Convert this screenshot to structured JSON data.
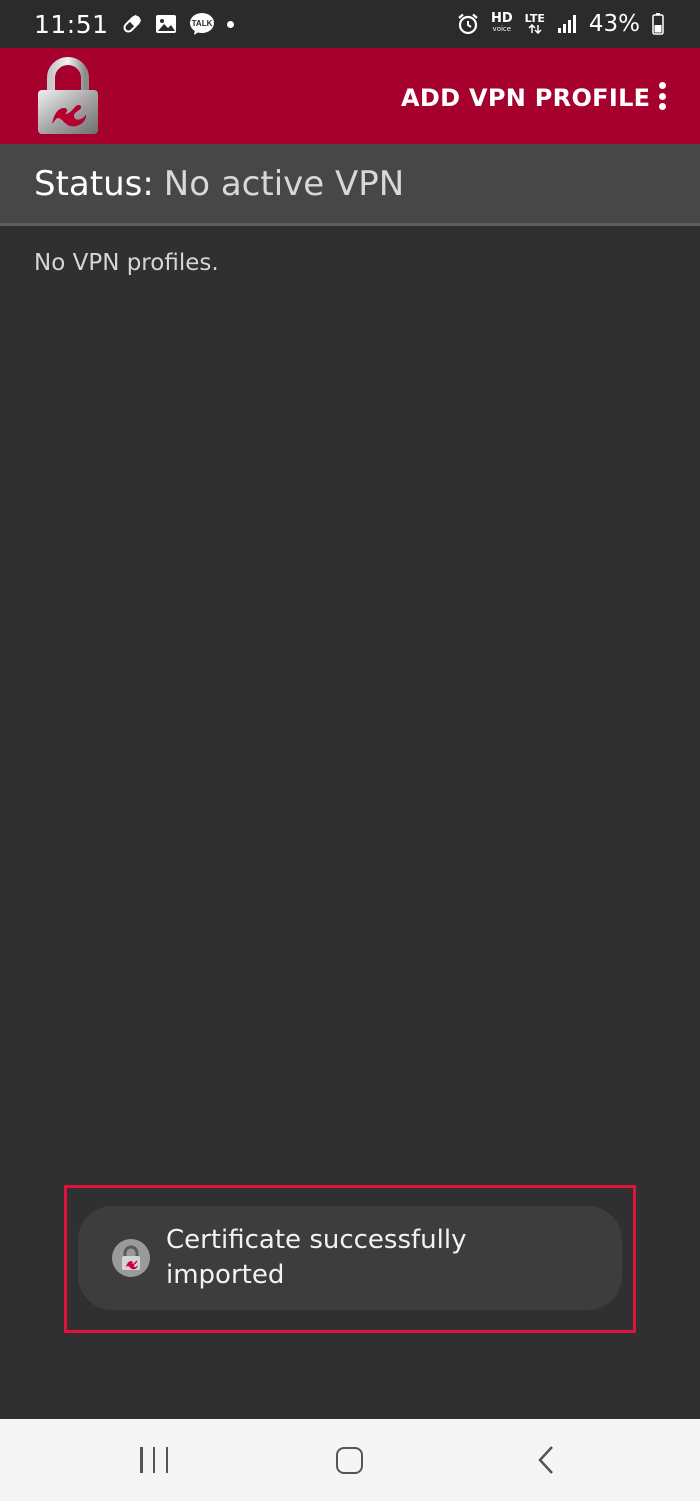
{
  "status_bar": {
    "time": "11:51",
    "left_icons": [
      "pill-icon",
      "image-icon",
      "talk-icon",
      "notification-dot-icon"
    ],
    "right_icons": [
      "alarm-icon",
      "hd-voice-icon",
      "lte-icon",
      "signal-icon",
      "battery-icon"
    ],
    "hd_label": "HD",
    "hd_sub": "voice",
    "lte_label": "LTE",
    "talk_label": "TALK",
    "battery": "43%"
  },
  "app_bar": {
    "logo_icon": "strongswan-padlock-logo",
    "add_profile_label": "ADD VPN PROFILE",
    "menu_icon": "more-vert-icon",
    "color": "#a6002d"
  },
  "status": {
    "label": "Status:",
    "value": "No active VPN"
  },
  "profiles": {
    "empty_text": "No VPN profiles."
  },
  "toast": {
    "icon": "strongswan-app-icon",
    "message": "Certificate successfully imported",
    "highlight_color": "#e0113a"
  },
  "nav_bar": {
    "buttons": [
      "recents-icon",
      "home-icon",
      "back-icon"
    ]
  }
}
